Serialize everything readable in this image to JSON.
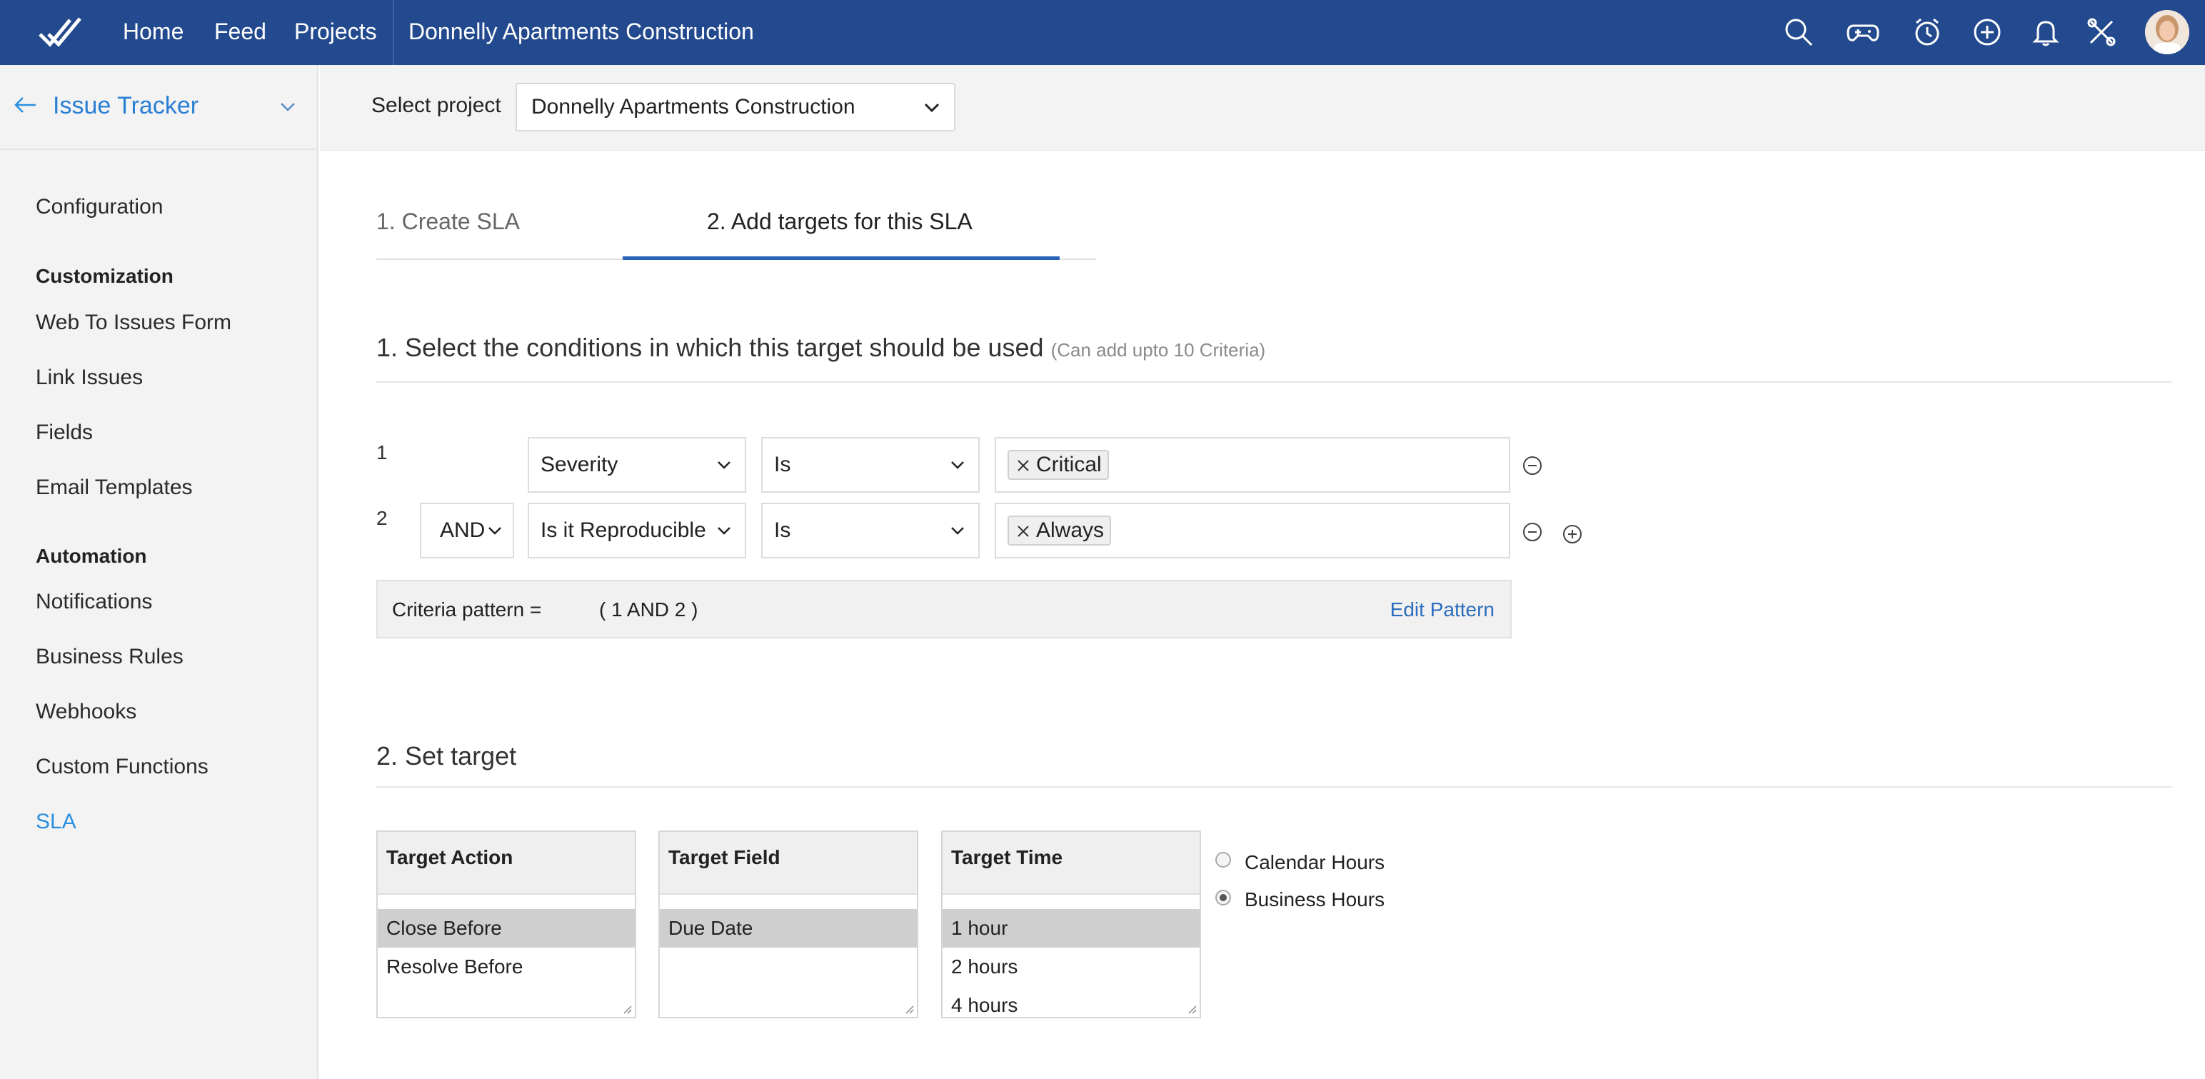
{
  "topbar": {
    "nav": [
      "Home",
      "Feed",
      "Projects"
    ],
    "project_title": "Donnelly Apartments Construction",
    "icons": [
      "search-icon",
      "gamepad-icon",
      "timer-icon",
      "add-icon",
      "bell-icon",
      "tools-icon"
    ],
    "color": "#234a8e"
  },
  "sidebar": {
    "header": "Issue Tracker",
    "configuration": "Configuration",
    "customization_group": "Customization",
    "customization_items": [
      "Web To Issues Form",
      "Link Issues",
      "Fields",
      "Email Templates"
    ],
    "automation_group": "Automation",
    "automation_items": [
      "Notifications",
      "Business Rules",
      "Webhooks",
      "Custom Functions",
      "SLA"
    ],
    "active_item": "SLA",
    "accent": "#2a8fe0"
  },
  "project_bar": {
    "label": "Select project",
    "selected": "Donnelly Apartments Construction"
  },
  "steps": {
    "step1": "1. Create SLA",
    "step2": "2. Add targets for this SLA",
    "active": 2
  },
  "conditions": {
    "title": "1. Select the conditions in which this target should be used",
    "note": "(Can add upto 10 Criteria)",
    "rows": [
      {
        "num": "1",
        "joiner": "",
        "field": "Severity",
        "operator": "Is",
        "value": "Critical"
      },
      {
        "num": "2",
        "joiner": "AND",
        "field": "Is it Reproducible",
        "operator": "Is",
        "value": "Always"
      }
    ],
    "pattern_label": "Criteria pattern =",
    "pattern_value": "( 1 AND 2 )",
    "edit_pattern": "Edit Pattern"
  },
  "target": {
    "title": "2. Set target",
    "action": {
      "header": "Target Action",
      "options": [
        "Close Before",
        "Resolve Before"
      ],
      "selected": "Close Before"
    },
    "field": {
      "header": "Target Field",
      "options": [
        "Due Date"
      ],
      "selected": "Due Date"
    },
    "time": {
      "header": "Target Time",
      "options": [
        "1 hour",
        "2 hours",
        "4 hours"
      ],
      "selected": "1 hour"
    },
    "hours_options": [
      "Calendar Hours",
      "Business Hours"
    ],
    "hours_selected": "Business Hours"
  }
}
